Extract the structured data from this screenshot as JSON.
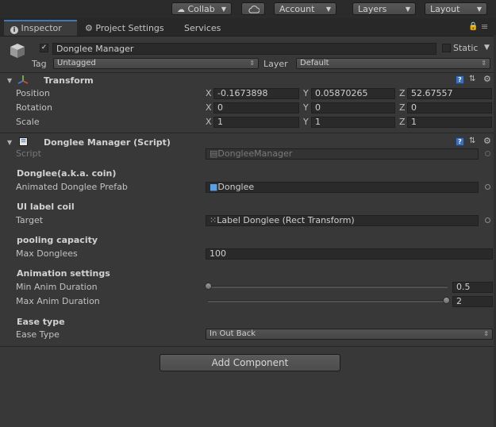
{
  "toolbar": {
    "collab": "Collab",
    "account": "Account",
    "layers": "Layers",
    "layout": "Layout"
  },
  "tabs": [
    {
      "label": "Inspector",
      "active": true
    },
    {
      "label": "Project Settings",
      "active": false
    },
    {
      "label": "Services",
      "active": false
    }
  ],
  "object": {
    "active_checked": true,
    "name": "Donglee Manager",
    "static_label": "Static",
    "tag_label": "Tag",
    "tag_value": "Untagged",
    "layer_label": "Layer",
    "layer_value": "Default"
  },
  "transform": {
    "title": "Transform",
    "position_label": "Position",
    "rotation_label": "Rotation",
    "scale_label": "Scale",
    "axis_x": "X",
    "axis_y": "Y",
    "axis_z": "Z",
    "position": {
      "x": "-0.1673898",
      "y": "0.05870265",
      "z": "52.67557"
    },
    "rotation": {
      "x": "0",
      "y": "0",
      "z": "0"
    },
    "scale": {
      "x": "1",
      "y": "1",
      "z": "1"
    }
  },
  "script_component": {
    "title": "Donglee Manager (Script)",
    "script_label": "Script",
    "script_value": "DongleeManager",
    "section1_header": "Donglee(a.k.a. coin)",
    "animated_prefab_label": "Animated Donglee Prefab",
    "animated_prefab_value": "Donglee",
    "section2_header": "UI label coil",
    "target_label": "Target",
    "target_value": "Label Donglee (Rect Transform)",
    "section3_header": "pooling capacity",
    "max_donglees_label": "Max Donglees",
    "max_donglees_value": "100",
    "section4_header": "Animation settings",
    "min_anim_label": "Min Anim Duration",
    "min_anim_value": "0.5",
    "min_anim_fraction": 0.0,
    "max_anim_label": "Max Anim Duration",
    "max_anim_value": "2",
    "max_anim_fraction": 1.0,
    "section5_header": "Ease type",
    "ease_type_label": "Ease Type",
    "ease_type_value": "In Out Back"
  },
  "add_component": "Add Component",
  "colors": {
    "background": "#383838",
    "tab_accent": "#3a79bb",
    "help_icon": "#3f6fb5"
  }
}
